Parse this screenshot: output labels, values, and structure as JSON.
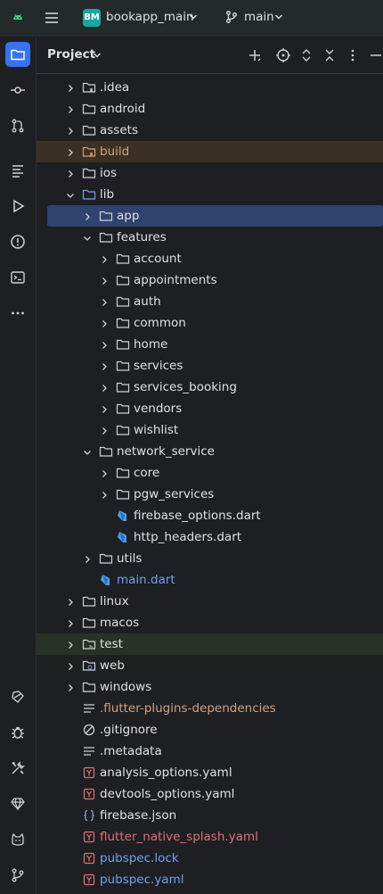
{
  "topbar": {
    "project_badge": "BM",
    "project_name": "bookapp_main",
    "branch_name": "main"
  },
  "panel": {
    "title": "Project"
  },
  "colors": {
    "accent": "#3573f0",
    "folder_excluded": "#d5a27c",
    "vcs_added": "#6ea1f0",
    "vcs_modified": "#e0707a"
  },
  "tree": {
    "items": [
      {
        "label": ".idea",
        "depth": 1,
        "chev": "right",
        "icon": "folder-config-icon",
        "color": ""
      },
      {
        "label": "android",
        "depth": 1,
        "chev": "right",
        "icon": "folder-icon",
        "color": ""
      },
      {
        "label": "assets",
        "depth": 1,
        "chev": "right",
        "icon": "folder-icon",
        "color": ""
      },
      {
        "label": "build",
        "depth": 1,
        "chev": "right",
        "icon": "folder-excluded-icon",
        "color": "orange",
        "hl": "build"
      },
      {
        "label": "ios",
        "depth": 1,
        "chev": "right",
        "icon": "folder-icon",
        "color": ""
      },
      {
        "label": "lib",
        "depth": 1,
        "chev": "down",
        "icon": "folder-source-icon",
        "color": ""
      },
      {
        "label": "app",
        "depth": 2,
        "chev": "right",
        "icon": "folder-icon",
        "color": "",
        "hl": "sel"
      },
      {
        "label": "features",
        "depth": 2,
        "chev": "down",
        "icon": "folder-icon",
        "color": ""
      },
      {
        "label": "account",
        "depth": 3,
        "chev": "right",
        "icon": "folder-icon",
        "color": ""
      },
      {
        "label": "appointments",
        "depth": 3,
        "chev": "right",
        "icon": "folder-icon",
        "color": ""
      },
      {
        "label": "auth",
        "depth": 3,
        "chev": "right",
        "icon": "folder-icon",
        "color": ""
      },
      {
        "label": "common",
        "depth": 3,
        "chev": "right",
        "icon": "folder-icon",
        "color": ""
      },
      {
        "label": "home",
        "depth": 3,
        "chev": "right",
        "icon": "folder-icon",
        "color": ""
      },
      {
        "label": "services",
        "depth": 3,
        "chev": "right",
        "icon": "folder-icon",
        "color": ""
      },
      {
        "label": "services_booking",
        "depth": 3,
        "chev": "right",
        "icon": "folder-icon",
        "color": ""
      },
      {
        "label": "vendors",
        "depth": 3,
        "chev": "right",
        "icon": "folder-icon",
        "color": ""
      },
      {
        "label": "wishlist",
        "depth": 3,
        "chev": "right",
        "icon": "folder-icon",
        "color": ""
      },
      {
        "label": "network_service",
        "depth": 2,
        "chev": "down",
        "icon": "folder-icon",
        "color": ""
      },
      {
        "label": "core",
        "depth": 3,
        "chev": "right",
        "icon": "folder-icon",
        "color": ""
      },
      {
        "label": "pgw_services",
        "depth": 3,
        "chev": "right",
        "icon": "folder-icon",
        "color": ""
      },
      {
        "label": "firebase_options.dart",
        "depth": 3,
        "chev": "",
        "icon": "dart-file-icon",
        "color": ""
      },
      {
        "label": "http_headers.dart",
        "depth": 3,
        "chev": "",
        "icon": "dart-file-icon",
        "color": ""
      },
      {
        "label": "utils",
        "depth": 2,
        "chev": "right",
        "icon": "folder-icon",
        "color": ""
      },
      {
        "label": "main.dart",
        "depth": 2,
        "chev": "",
        "icon": "dart-file-icon",
        "color": "blue"
      },
      {
        "label": "linux",
        "depth": 1,
        "chev": "right",
        "icon": "folder-icon",
        "color": ""
      },
      {
        "label": "macos",
        "depth": 1,
        "chev": "right",
        "icon": "folder-icon",
        "color": ""
      },
      {
        "label": "test",
        "depth": 1,
        "chev": "right",
        "icon": "folder-test-icon",
        "color": "",
        "hl": "test"
      },
      {
        "label": "web",
        "depth": 1,
        "chev": "right",
        "icon": "folder-web-icon",
        "color": ""
      },
      {
        "label": "windows",
        "depth": 1,
        "chev": "right",
        "icon": "folder-icon",
        "color": ""
      },
      {
        "label": ".flutter-plugins-dependencies",
        "depth": 1,
        "chev": "",
        "icon": "text-file-icon",
        "color": "orange"
      },
      {
        "label": ".gitignore",
        "depth": 1,
        "chev": "",
        "icon": "ignore-file-icon",
        "color": ""
      },
      {
        "label": ".metadata",
        "depth": 1,
        "chev": "",
        "icon": "text-file-icon",
        "color": ""
      },
      {
        "label": "analysis_options.yaml",
        "depth": 1,
        "chev": "",
        "icon": "yaml-file-icon",
        "color": ""
      },
      {
        "label": "devtools_options.yaml",
        "depth": 1,
        "chev": "",
        "icon": "yaml-file-icon",
        "color": ""
      },
      {
        "label": "firebase.json",
        "depth": 1,
        "chev": "",
        "icon": "json-file-icon",
        "color": ""
      },
      {
        "label": "flutter_native_splash.yaml",
        "depth": 1,
        "chev": "",
        "icon": "yaml-file-icon",
        "color": "red"
      },
      {
        "label": "pubspec.lock",
        "depth": 1,
        "chev": "",
        "icon": "yaml-file-icon",
        "color": "blue"
      },
      {
        "label": "pubspec.yaml",
        "depth": 1,
        "chev": "",
        "icon": "yaml-file-icon",
        "color": "blue"
      }
    ]
  }
}
